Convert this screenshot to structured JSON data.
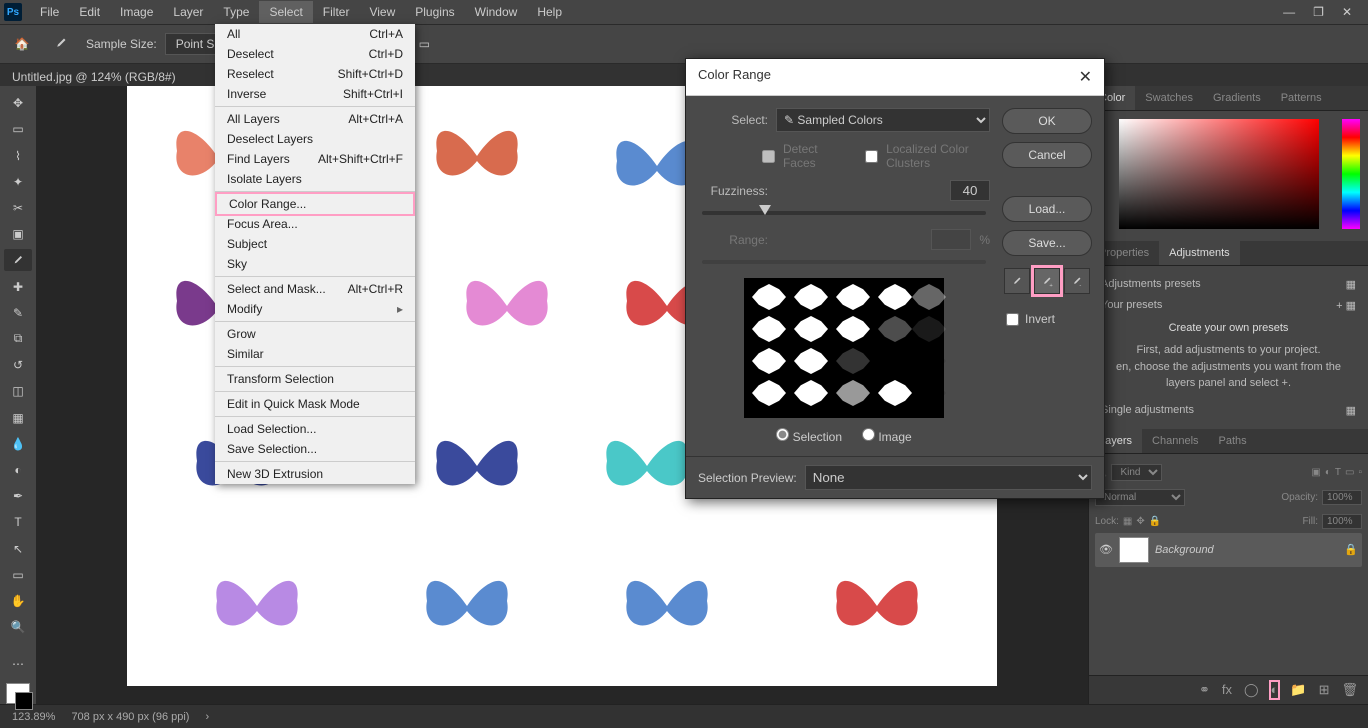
{
  "menubar": {
    "items": [
      "File",
      "Edit",
      "Image",
      "Layer",
      "Type",
      "Select",
      "Filter",
      "View",
      "Plugins",
      "Window",
      "Help"
    ],
    "active_index": 5
  },
  "options_bar": {
    "sample_size_label": "Sample Size:",
    "sample_size_value": "Point S"
  },
  "document": {
    "tab_title": "Untitled.jpg @ 124% (RGB/8#)"
  },
  "select_menu": {
    "groups": [
      [
        {
          "label": "All",
          "shortcut": "Ctrl+A",
          "disabled": false
        },
        {
          "label": "Deselect",
          "shortcut": "Ctrl+D",
          "disabled": false
        },
        {
          "label": "Reselect",
          "shortcut": "Shift+Ctrl+D",
          "disabled": false
        },
        {
          "label": "Inverse",
          "shortcut": "Shift+Ctrl+I",
          "disabled": false
        }
      ],
      [
        {
          "label": "All Layers",
          "shortcut": "Alt+Ctrl+A",
          "disabled": false
        },
        {
          "label": "Deselect Layers",
          "shortcut": "",
          "disabled": false
        },
        {
          "label": "Find Layers",
          "shortcut": "Alt+Shift+Ctrl+F",
          "disabled": false
        },
        {
          "label": "Isolate Layers",
          "shortcut": "",
          "disabled": false
        }
      ],
      [
        {
          "label": "Color Range...",
          "shortcut": "",
          "disabled": false,
          "highlighted": true
        },
        {
          "label": "Focus Area...",
          "shortcut": "",
          "disabled": false
        },
        {
          "label": "Subject",
          "shortcut": "",
          "disabled": false
        },
        {
          "label": "Sky",
          "shortcut": "",
          "disabled": false
        }
      ],
      [
        {
          "label": "Select and Mask...",
          "shortcut": "Alt+Ctrl+R",
          "disabled": false
        },
        {
          "label": "Modify",
          "shortcut": "",
          "disabled": false,
          "submenu": true
        }
      ],
      [
        {
          "label": "Grow",
          "shortcut": "",
          "disabled": false
        },
        {
          "label": "Similar",
          "shortcut": "",
          "disabled": false
        }
      ],
      [
        {
          "label": "Transform Selection",
          "shortcut": "",
          "disabled": false
        }
      ],
      [
        {
          "label": "Edit in Quick Mask Mode",
          "shortcut": "",
          "disabled": false
        }
      ],
      [
        {
          "label": "Load Selection...",
          "shortcut": "",
          "disabled": false
        },
        {
          "label": "Save Selection...",
          "shortcut": "",
          "disabled": false
        }
      ],
      [
        {
          "label": "New 3D Extrusion",
          "shortcut": "",
          "disabled": false
        }
      ]
    ]
  },
  "color_range_dialog": {
    "title": "Color Range",
    "select_label": "Select:",
    "select_value": "Sampled Colors",
    "detect_faces_label": "Detect Faces",
    "localized_label": "Localized Color Clusters",
    "fuzziness_label": "Fuzziness:",
    "fuzziness_value": "40",
    "range_label": "Range:",
    "range_unit": "%",
    "radio_selection": "Selection",
    "radio_image": "Image",
    "preview_label": "Selection Preview:",
    "preview_value": "None",
    "buttons": {
      "ok": "OK",
      "cancel": "Cancel",
      "load": "Load...",
      "save": "Save..."
    },
    "invert_label": "Invert"
  },
  "right_panels": {
    "color_tabs": [
      "Color",
      "Swatches",
      "Gradients",
      "Patterns"
    ],
    "props_tabs": [
      "Properties",
      "Adjustments"
    ],
    "adjustments": {
      "presets_label": "Adjustments presets",
      "your_presets": "Your presets",
      "create_title": "Create your own presets",
      "create_body1": "First, add adjustments to your project.",
      "create_body2": "en, choose the adjustments you want from the layers panel and select  +.",
      "single_label": "Single adjustments"
    },
    "layers_tabs": [
      "Layers",
      "Channels",
      "Paths"
    ],
    "layers": {
      "kind_label": "Kind",
      "blend_mode": "Normal",
      "opacity_label": "Opacity:",
      "opacity_value": "100%",
      "lock_label": "Lock:",
      "fill_label": "Fill:",
      "fill_value": "100%",
      "layer_name": "Background"
    }
  },
  "status_bar": {
    "zoom": "123.89%",
    "dimensions": "708 px x 490 px (96 ppi)"
  }
}
